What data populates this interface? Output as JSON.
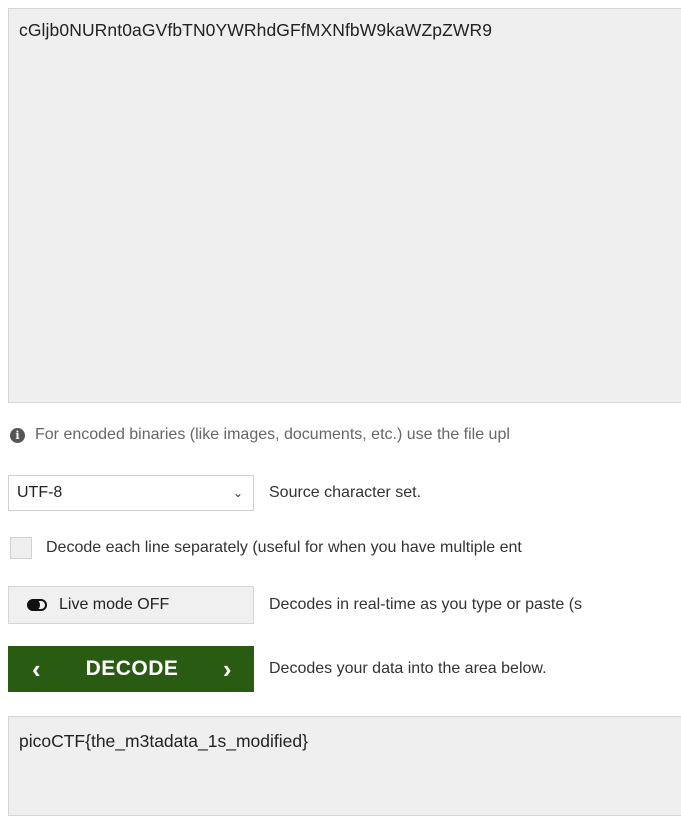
{
  "input": {
    "value": "cGljb0NURnt0aGVfbTN0YWRhdGFfMXNfbW9kaWZpZWR9"
  },
  "note": {
    "text": "For encoded binaries (like images, documents, etc.) use the file upl"
  },
  "charset": {
    "selected": "UTF-8",
    "description": "Source character set."
  },
  "line_option": {
    "label": "Decode each line separately (useful for when you have multiple ent"
  },
  "live_mode": {
    "label": "Live mode OFF",
    "description": "Decodes in real-time as you type or paste (s"
  },
  "decode": {
    "label": "DECODE",
    "description": "Decodes your data into the area below."
  },
  "output": {
    "value": "picoCTF{the_m3tadata_1s_modified}"
  },
  "colors": {
    "decode_button": "#2a5b13",
    "textarea_bg": "#efefef"
  }
}
